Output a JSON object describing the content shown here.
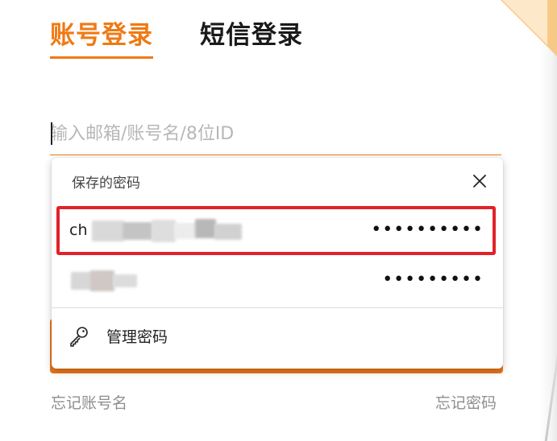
{
  "tabs": {
    "account_login": "账号登录",
    "sms_login": "短信登录"
  },
  "account_input": {
    "placeholder": "输入邮箱/账号名/8位ID",
    "value": ""
  },
  "saved_passwords": {
    "title": "保存的密码",
    "credentials": [
      {
        "username_visible": "ch",
        "password_mask": "••••••••••"
      },
      {
        "username_visible": "",
        "password_mask": "•••••••••"
      }
    ],
    "manage_label": "管理密码"
  },
  "links": {
    "forgot_account": "忘记账号名",
    "forgot_password": "忘记密码"
  },
  "colors": {
    "accent": "#ef7a14",
    "highlight": "#e1222b",
    "button": "#e8741a"
  },
  "icons": {
    "close": "close-icon",
    "key": "key-icon"
  }
}
